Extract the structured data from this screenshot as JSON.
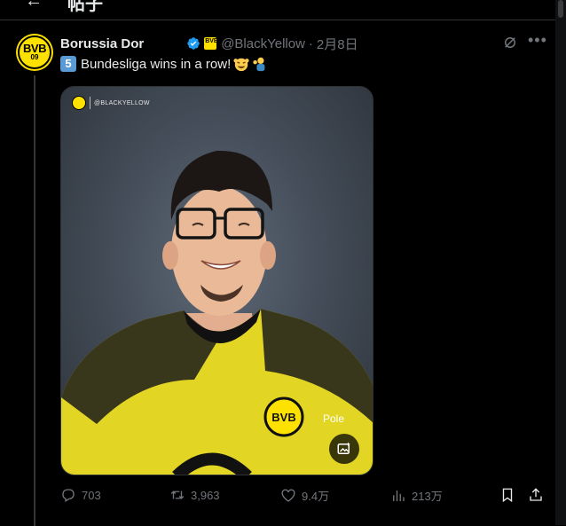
{
  "header_bar": {
    "back_glyph": "←",
    "title": "帖子"
  },
  "post": {
    "author_name": "Borussia Dor",
    "verified_icon": "verified-check-icon",
    "affiliate_badge": "bvb-badge-icon",
    "handle": "@BlackYellow",
    "separator": "·",
    "date": "2月8日",
    "text": "Bundesliga wins in a row!",
    "keycap_number": "5",
    "emojis": [
      "celebrating-face-icon",
      "fist-pump-person-icon"
    ],
    "media": {
      "watermark_text": "@BLACKYELLOW",
      "alt_text_icon": "image-edit-icon"
    },
    "more_glyph": "•••",
    "grok_icon": "grok-icon"
  },
  "avatar": {
    "line1": "BVB",
    "line2": "09"
  },
  "actions": {
    "reply_count": "703",
    "retweet_count": "3,963",
    "like_count": "9.4万",
    "views_count": "213万"
  },
  "colors": {
    "background": "#000000",
    "text_primary": "#e7e9ea",
    "text_secondary": "#71767b",
    "bvb_yellow": "#fde100",
    "verified_blue": "#1d9bf0"
  }
}
